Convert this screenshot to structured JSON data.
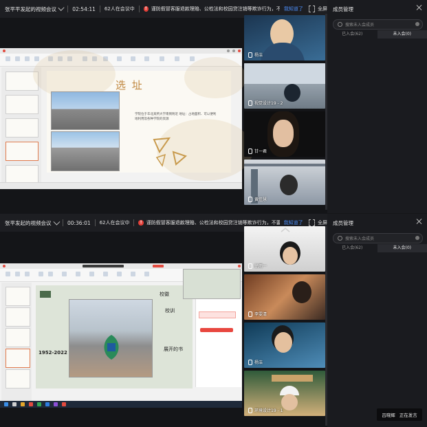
{
  "panels": [
    {
      "meeting_title": "张平平发起的视频会议",
      "duration": "02:54:11",
      "online_count": "62人在会议中",
      "notice": "谨防假冒客服退款理赔、公检法和校园贷注销等欺诈行为，不要…",
      "acknowledge": "我知道了",
      "fullscreen": "全屏",
      "slide_heading": "选 址",
      "slide_text": "学院位于华北某所大学南侧附近 地址：占地面积、可以便利地利用及各种学院的资源",
      "participants": [
        {
          "name": "杨洁",
          "colors": [
            "#2a4b6e",
            "#e9c9a5"
          ]
        },
        {
          "name": "视觉设计19 - 2",
          "colors": [
            "#6f7b86",
            "#b5c3cf"
          ]
        },
        {
          "name": "甘一君",
          "colors": [
            "#1a1a1a",
            "#e2bfa1"
          ]
        },
        {
          "name": "黄佳慧",
          "colors": [
            "#9aa7b5",
            "#d5d9de"
          ]
        }
      ],
      "sidebar": {
        "title": "成员管理",
        "search_placeholder": "搜索未入会成员",
        "tabs": [
          "已入会(62)",
          "未入会(0)"
        ]
      }
    },
    {
      "meeting_title": "张平发起的视频会议",
      "duration": "00:36:01",
      "online_count": "62人在会议中",
      "notice": "谨防假冒客服退款理赔、公检法和校园贷注销等欺诈行为，不要…",
      "acknowledge": "我知道了",
      "fullscreen": "全屏",
      "slide_heading": "",
      "slide_year": "1952-2022",
      "slide_labels": [
        "校徽",
        "校训",
        "展开的书"
      ],
      "participants": [
        {
          "name": "徐雨一",
          "colors": [
            "#d8d8d8",
            "#f0f0f0"
          ]
        },
        {
          "name": "李雯清",
          "colors": [
            "#8a5a3a",
            "#d29a6a"
          ]
        },
        {
          "name": "杨洁",
          "colors": [
            "#20506e",
            "#6fa3c8"
          ]
        },
        {
          "name": "环境设计19 - 1",
          "colors": [
            "#35523a",
            "#caa26d"
          ]
        }
      ],
      "sidebar": {
        "title": "成员管理",
        "search_placeholder": "搜索未入会成员",
        "tabs": [
          "已入会(62)",
          "未入会(0)"
        ]
      }
    }
  ],
  "speaking_toast": {
    "name": "吕晓辉",
    "status": "正在发言"
  }
}
